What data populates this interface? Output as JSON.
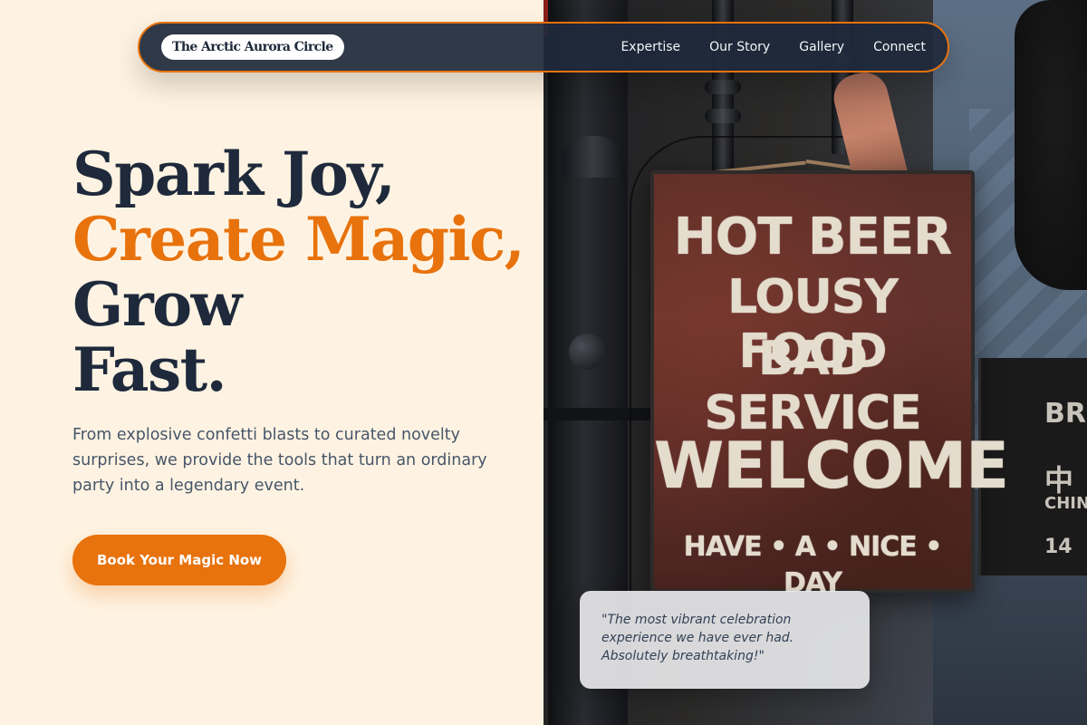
{
  "nav": {
    "brand": "The Arctic Aurora Circle",
    "links": [
      "Expertise",
      "Our Story",
      "Gallery",
      "Connect"
    ]
  },
  "hero": {
    "title_1": "Spark Joy,",
    "title_2": "Create Magic,",
    "title_3": "Grow",
    "title_4": "Fast.",
    "subtitle": "From explosive confetti blasts to curated novelty surprises, we provide the tools that turn an ordinary party into a legendary event.",
    "cta": "Book Your Magic Now"
  },
  "photo": {
    "sign_lines": [
      "Hot Beer",
      "Lousy Food",
      "Bad Service",
      "Welcome",
      "Have • A • Nice • Day"
    ],
    "bar_sign": [
      "BRE",
      "中",
      "CHINE",
      "14"
    ]
  },
  "testimonial": {
    "quote": "\"The most vibrant celebration experience we have ever had. Absolutely breathtaking!\""
  },
  "colors": {
    "background": "#fef3e2",
    "accent": "#e8720c",
    "navy": "#1e293b",
    "muted": "#475569"
  }
}
